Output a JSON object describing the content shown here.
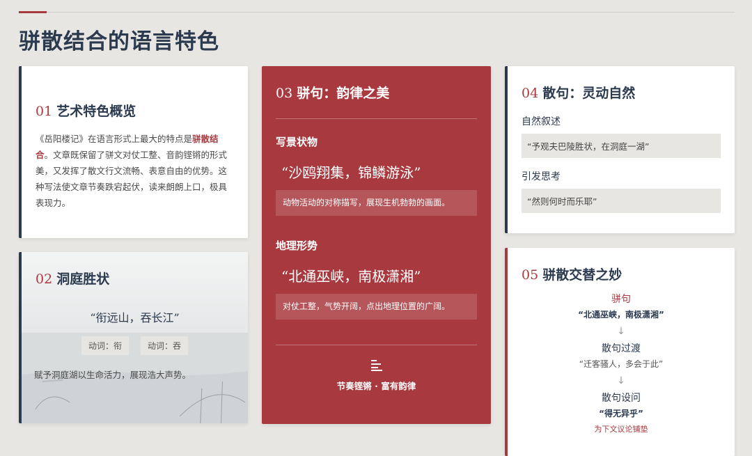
{
  "page": {
    "title": "骈散结合的语言特色"
  },
  "card1": {
    "num": "01",
    "title": "艺术特色概览",
    "text_before": "《岳阳楼记》在语言形式上最大的特点是",
    "highlight": "骈散结合",
    "text_after": "。文章既保留了骈文对仗工整、音韵铿锵的形式美，又发挥了散文行文流畅、表意自由的优势。这种写法使文章节奏跌宕起伏，读来朗朗上口，极具表现力。"
  },
  "card2": {
    "num": "02",
    "title": "洞庭胜状",
    "quote": "“衔远山，吞长江”",
    "tags": [
      "动词：衔",
      "动词：吞"
    ],
    "desc": "赋予洞庭湖以生命活力，展现浩大声势。"
  },
  "card3": {
    "num": "03",
    "title": "骈句：韵律之美",
    "sections": [
      {
        "heading": "写景状物",
        "quote": "“沙鸥翔集，锦鳞游泳”",
        "note": "动物活动的对称描写，展现生机勃勃的画面。"
      },
      {
        "heading": "地理形势",
        "quote": "“北通巫峡，南极潇湘”",
        "note": "对仗工整，气势开阔，点出地理位置的广阔。"
      }
    ],
    "footer": "节奏铿锵 · 富有韵律",
    "footer_icon": "align-left-icon"
  },
  "card4": {
    "num": "04",
    "title": "散句：灵动自然",
    "items": [
      {
        "label": "自然叙述",
        "quote": "“予观夫巴陵胜状，在洞庭一湖”"
      },
      {
        "label": "引发思考",
        "quote": "“然则何时而乐耶”"
      }
    ]
  },
  "card5": {
    "num": "05",
    "title": "骈散交替之妙",
    "steps": [
      {
        "head": "骈句",
        "quote": "“北通巫峡，南极潇湘”"
      },
      {
        "head": "散句过渡",
        "quote": "“迁客骚人，多会于此”"
      },
      {
        "head": "散句设问",
        "quote": "“得无异乎”"
      }
    ],
    "footer": "为下文议论铺垫",
    "arrow": "↓"
  },
  "colors": {
    "accent_red": "#a8393f",
    "navy": "#2b3a4f",
    "background": "#e8e6e2"
  }
}
